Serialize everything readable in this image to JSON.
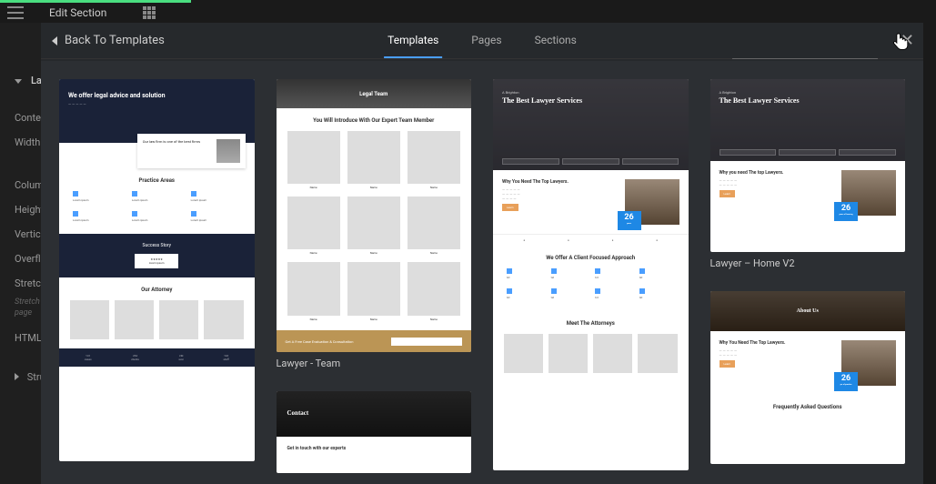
{
  "topbar": {
    "title": "Edit Section"
  },
  "sidebar_left_icon": {
    "label": "Layout"
  },
  "left_panel": {
    "section_layout_label": "Lay",
    "items": {
      "content": "Conten",
      "width": "Width",
      "columns": "Column",
      "height": "Height",
      "vertical": "Vertica",
      "overflow": "Overflo",
      "stretch": "Stretch",
      "stretch_hint": "Stretch the section to the full width of the page",
      "html": "HTML T",
      "structure": "Stru"
    }
  },
  "modal": {
    "back_label": "Back To Templates",
    "tabs": {
      "templates": "Templates",
      "pages": "Pages",
      "sections": "Sections"
    }
  },
  "templates": {
    "t1": {
      "hero_title": "We offer legal advice and solution",
      "float_text": "Our law firm is one of the best firms",
      "practice_title": "Practice Areas",
      "success_title": "Success Story",
      "attorney_title": "Our Attorney",
      "stats": [
        "141",
        "254",
        "2M",
        "143"
      ]
    },
    "t2": {
      "header_badge": "Legal Team",
      "subtitle": "You Will Introduce With Our Expert Team Member",
      "cta_text": "Get A Free Case Evaluation & Consultation",
      "label": "Lawyer - Team"
    },
    "t3": {
      "eyebrow": "A Brighton",
      "hero_title": "The Best Lawyer Services",
      "why_title": "Why You Need The Top Lawyers.",
      "badge_number": "26",
      "approach_title": "We Offer A Client Focused Approach",
      "meet_title": "Meet The Attorneys"
    },
    "t4": {
      "eyebrow": "A Brighton",
      "hero_title": "The Best Lawyer Services",
      "why_title": "Why you need The top Lawyers.",
      "badge_number": "26",
      "label": "Lawyer – Home V2"
    },
    "t5": {
      "hero_title": "Contact",
      "body_title": "Get in touch with our experts"
    },
    "t6": {
      "hero_title": "About Us",
      "why_title": "Why You Need The Top Lawyers.",
      "badge_number": "26",
      "faq_title": "Frequently Asked Questions"
    }
  }
}
